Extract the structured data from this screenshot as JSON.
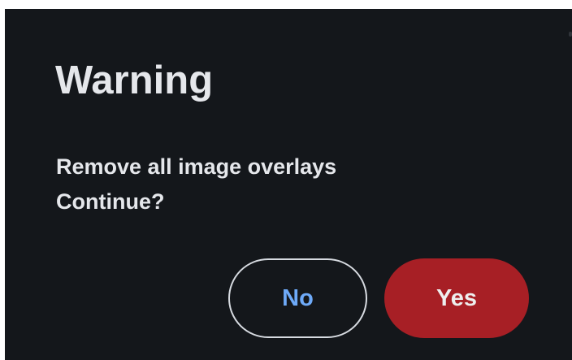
{
  "dialog": {
    "title": "Warning",
    "message_lines": [
      "Remove all image overlays",
      "Continue?"
    ],
    "buttons": {
      "no_label": "No",
      "yes_label": "Yes"
    },
    "colors": {
      "background": "#14171b",
      "text": "#e5e7eb",
      "no_text": "#6eaaf8",
      "yes_background": "#a71f25"
    }
  }
}
